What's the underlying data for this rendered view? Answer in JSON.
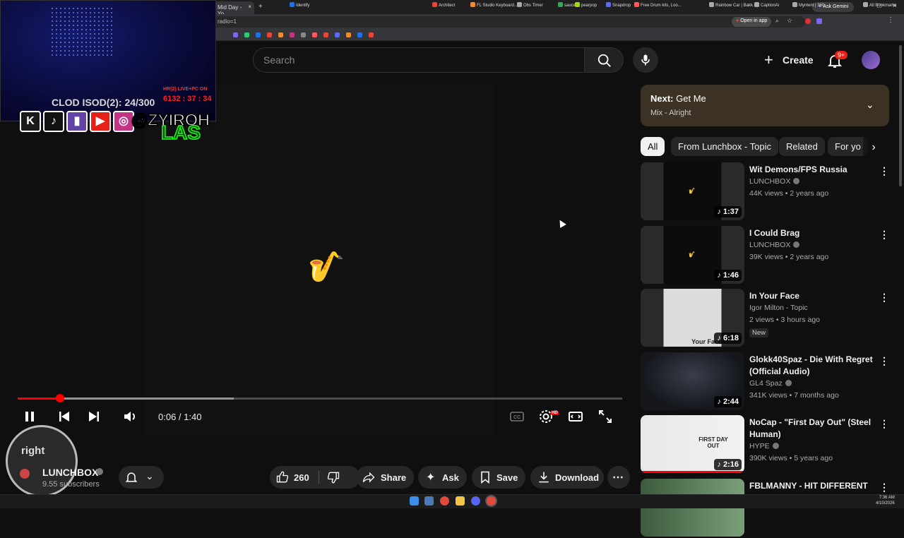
{
  "browser": {
    "tab_title": "Mid Day - Yo",
    "tab_close": "×",
    "new_tab": "+",
    "omnibox_text": "radio=1",
    "open_in_app": "Open in app",
    "ask_gemini": "Ask Gemini",
    "window_minimize": "–",
    "window_maximize": "□",
    "window_close": "×",
    "bookmarks": [
      {
        "label": "Identify",
        "color": "#1a73e8"
      },
      {
        "label": "Architect",
        "color": "#e8453c"
      },
      {
        "label": "FL Studio Keyboard...",
        "color": "#f28c28"
      },
      {
        "label": "Obs Timer",
        "color": "#aaaaaa"
      },
      {
        "label": "sauce",
        "color": "#34a853"
      },
      {
        "label": "pearpop",
        "color": "#a0d911"
      },
      {
        "label": "Snapdrop",
        "color": "#5b6cf2"
      },
      {
        "label": "Free Drum kits, Loo...",
        "color": "#ff5a5a"
      },
      {
        "label": "Rainbow Car | Bakk...",
        "color": "#aaaaaa"
      },
      {
        "label": "CaptionAi",
        "color": "#aaaaaa"
      },
      {
        "label": "Myntent | 360",
        "color": "#aaaaaa"
      },
      {
        "label": "All Bookmarks",
        "color": "#aaaaaa"
      }
    ]
  },
  "youtube": {
    "search_placeholder": "Search",
    "create_label": "Create",
    "notifications_badge": "9+"
  },
  "stream_overlay": {
    "live_text": "HR(2) LIVE+PC ON",
    "clock": "6132 : 37 : 34",
    "cloud_text": "CLOD ISOD(2): 24/300",
    "handle": "@ZYIROH",
    "las_text": "LAS",
    "social_letters": [
      "K",
      "♪",
      "▮",
      "▶",
      "◎"
    ],
    "social_colors": [
      "#1a1a1a",
      "#111111",
      "#6441a5",
      "#e62117",
      "#c13584"
    ]
  },
  "player": {
    "time": "0:06 / 1:40",
    "played_fraction": 0.07,
    "buffered_fraction": 0.357,
    "hd_badge": "HD"
  },
  "channel": {
    "logo_text": "right",
    "name": "LUNCHBOX",
    "subscribers": "9.55 subscribers"
  },
  "actions": {
    "likes": "260",
    "share": "Share",
    "ask": "Ask",
    "save": "Save",
    "download": "Download"
  },
  "up_next": {
    "label_prefix": "Next:",
    "title": "Get Me",
    "subtitle": "Mix - Alright"
  },
  "chips": [
    "All",
    "From Lunchbox - Topic",
    "Related",
    "For yo"
  ],
  "recommendations": [
    {
      "title": "Wit Demons/FPS Russia",
      "channel": "LUNCHBOX",
      "verified": true,
      "meta": "44K views • 2 years ago",
      "duration": "1:37",
      "badge": "",
      "thumb_text": ""
    },
    {
      "title": "I Could Brag",
      "channel": "LUNCHBOX",
      "verified": true,
      "meta": "39K views • 2 years ago",
      "duration": "1:46",
      "badge": "",
      "thumb_text": ""
    },
    {
      "title": "In Your Face",
      "channel": "Igor Milton - Topic",
      "verified": false,
      "meta": "2 views • 3 hours ago",
      "duration": "6:18",
      "badge": "New",
      "thumb_text": "Your Face"
    },
    {
      "title": "Glokk40Spaz - Die With Regret (Official Audio)",
      "channel": "GL4 Spaz",
      "verified": true,
      "meta": "341K views • 7 months ago",
      "duration": "2:44",
      "badge": "",
      "thumb_text": ""
    },
    {
      "title": "NoCap - \"First Day Out\" (Steel Human)",
      "channel": "HYPE",
      "verified": true,
      "meta": "390K views • 5 years ago",
      "duration": "2:16",
      "badge": "",
      "thumb_text": "FIRST DAY OUT"
    },
    {
      "title": "FBLMANNY - HIT DIFFERENT",
      "channel": "",
      "verified": false,
      "meta": "",
      "duration": "",
      "badge": "",
      "thumb_text": ""
    }
  ],
  "taskbar": {
    "time": "7:36 AM",
    "date": "4/10/2026"
  }
}
